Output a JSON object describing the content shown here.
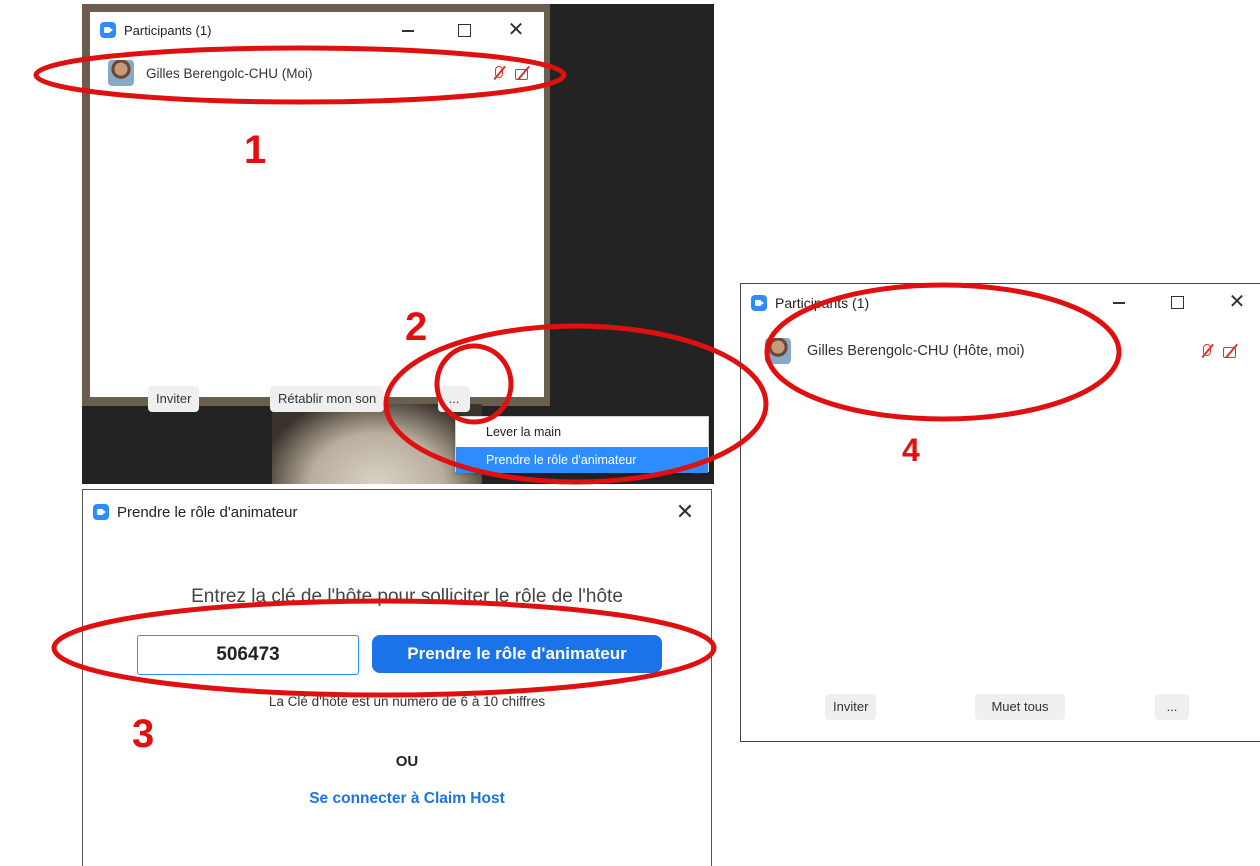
{
  "panel1": {
    "title": "Participants (1)",
    "participant_name": "Gilles Berengolc-CHU (Moi)",
    "invite_label": "Inviter",
    "unmute_label": "Rétablir mon son",
    "more_label": "...",
    "menu": [
      "Lever la main",
      "Prendre le rôle d'animateur"
    ]
  },
  "panel3": {
    "title": "Prendre le rôle d'animateur",
    "prompt": "Entrez la clé de l'hôte pour solliciter le rôle de l'hôte",
    "host_key": "506473",
    "claim_button": "Prendre le rôle d'animateur",
    "hint": "La Clé d'hôte est un numéro de 6 à 10 chiffres",
    "or": "OU",
    "signin_link": "Se connecter à Claim Host"
  },
  "panel4": {
    "title": "Participants (1)",
    "participant_name": "Gilles Berengolc-CHU (Hôte, moi)",
    "invite_label": "Inviter",
    "mute_all_label": "Muet tous",
    "more_label": "..."
  },
  "annotations": {
    "step1": "1",
    "step2": "2",
    "step3": "3",
    "step4": "4",
    "color": "#e01010"
  },
  "colors": {
    "zoom_blue": "#2d8cff",
    "button_blue": "#1a73e8",
    "muted_red": "#e03030"
  }
}
